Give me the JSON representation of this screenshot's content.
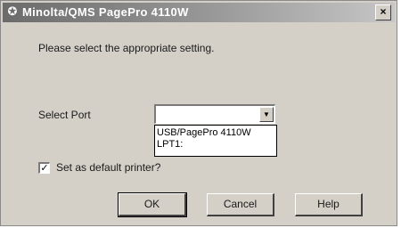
{
  "window": {
    "title": "Minolta/QMS PagePro 4110W",
    "close_glyph": "×",
    "app_icon": "printer-icon"
  },
  "content": {
    "instructions": "Please select the appropriate setting.",
    "port_label": "Select Port",
    "port_selected": "",
    "port_options": [
      "USB/PagePro 4110W",
      "LPT1:"
    ],
    "default_printer_label": "Set as default printer?",
    "default_printer_checked": true
  },
  "buttons": {
    "ok": "OK",
    "cancel": "Cancel",
    "help": "Help"
  }
}
